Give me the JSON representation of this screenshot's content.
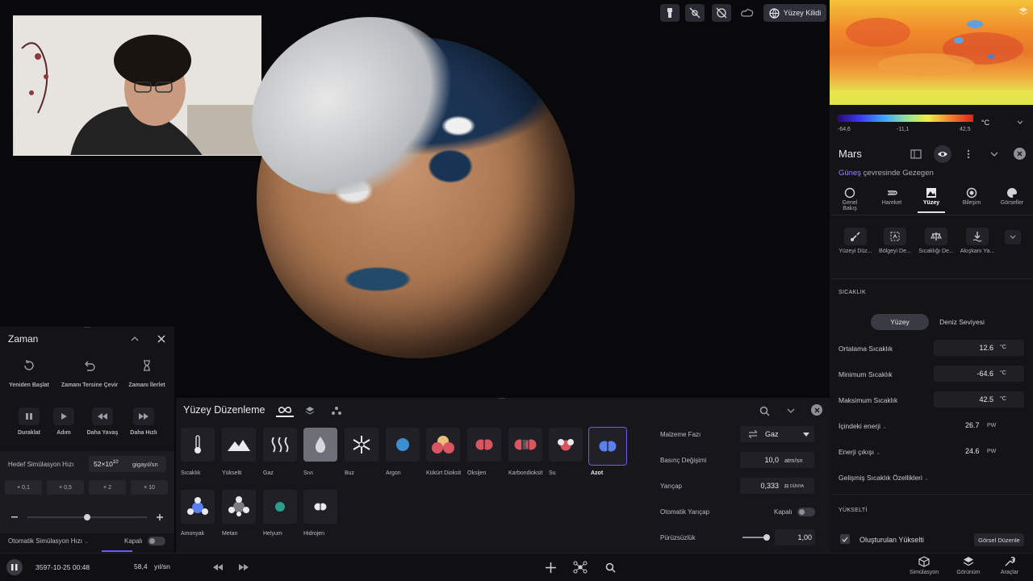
{
  "toolbar": {
    "surface_lock_label": "Yüzey Kilidi"
  },
  "legend": {
    "min": "-64,6",
    "mid": "-11,1",
    "max": "42,5",
    "unit": "°C"
  },
  "planet_panel": {
    "name": "Mars",
    "subtitle_link": "Güneş",
    "subtitle_rest": " çevresinde Gezegen",
    "tabs": [
      {
        "label": "Genel Bakış",
        "icon": "circle-icon"
      },
      {
        "label": "Hareket",
        "icon": "motion-icon"
      },
      {
        "label": "Yüzey",
        "icon": "surface-icon"
      },
      {
        "label": "Bileşim",
        "icon": "composition-icon"
      },
      {
        "label": "Görseller",
        "icon": "palette-icon"
      }
    ],
    "tools": [
      {
        "label": "Yüzeyi Düz...",
        "icon": "brush-icon"
      },
      {
        "label": "Bölgeyi De...",
        "icon": "region-icon"
      },
      {
        "label": "Sıcaklığı De...",
        "icon": "scale-icon"
      },
      {
        "label": "Akışkanı Ya...",
        "icon": "fluid-icon"
      }
    ],
    "temp_section": "SICAKLIK",
    "seg_surface": "Yüzey",
    "seg_sea": "Deniz Seviyesi",
    "rows": [
      {
        "label": "Ortalama Sıcaklık",
        "value": "12.6",
        "unit": "°C"
      },
      {
        "label": "Minimum Sıcaklık",
        "value": "-64.6",
        "unit": "°C"
      },
      {
        "label": "Maksimum Sıcaklık",
        "value": "42.5",
        "unit": "°C"
      }
    ],
    "energy_rows": [
      {
        "label": "İçindeki enerji",
        "value": "26.7",
        "unit": "PW"
      },
      {
        "label": "Enerji çıkışı",
        "value": "24.6",
        "unit": "PW"
      }
    ],
    "advanced": "Gelişmiş Sıcaklık Özellikleri",
    "elev_section": "YÜKSELTİ",
    "generated_elev": "Oluşturulan Yükselti",
    "visual_edit": "Görsel Düzenle"
  },
  "zaman": {
    "title": "Zaman",
    "buttons": [
      {
        "label": "Yeniden Başlat"
      },
      {
        "label": "Zamanı Tersine Çevir"
      },
      {
        "label": "Zamanı İlerlet"
      }
    ],
    "controls": [
      {
        "label": "Duraklat"
      },
      {
        "label": "Adım"
      },
      {
        "label": "Daha Yavaş"
      },
      {
        "label": "Daha Hızlı"
      }
    ],
    "target_label": "Hedef Simülasyon Hızı",
    "target_value": "52×10",
    "target_exp": "10",
    "target_unit": "gigayıl/sn",
    "multipliers": [
      "× 0,1",
      "× 0,5",
      "× 2",
      "× 10"
    ],
    "slider_value": 0.5,
    "auto_label": "Otomatik Simülasyon Hızı",
    "auto_state": "Kapalı"
  },
  "yuzey": {
    "title": "Yüzey Düzenleme",
    "materials": [
      {
        "label": "Sıcaklık",
        "icon": "thermometer-icon"
      },
      {
        "label": "Yükselti",
        "icon": "mountain-icon"
      },
      {
        "label": "Gaz",
        "icon": "gas-icon"
      },
      {
        "label": "Sıvı",
        "icon": "droplet-icon"
      },
      {
        "label": "Buz",
        "icon": "snowflake-icon"
      },
      {
        "label": "Argon",
        "icon": "argon-icon",
        "color": "#3b8fd0"
      },
      {
        "label": "Kükürt Dioksit",
        "icon": "sulfur-dioxide-icon"
      },
      {
        "label": "Oksijen",
        "icon": "oxygen-icon",
        "color": "#d9555f"
      },
      {
        "label": "Karbondioksit",
        "icon": "co2-icon"
      },
      {
        "label": "Su",
        "icon": "water-icon"
      },
      {
        "label": "Azot",
        "icon": "nitrogen-icon",
        "color": "#5a7ff0"
      }
    ],
    "materials2": [
      {
        "label": "Amonyak",
        "icon": "ammonia-icon"
      },
      {
        "label": "Metan",
        "icon": "methane-icon"
      },
      {
        "label": "Helyum",
        "icon": "helium-icon",
        "color": "#2a9d8f"
      },
      {
        "label": "Hidrojen",
        "icon": "hydrogen-icon"
      }
    ],
    "props": {
      "phase_label": "Malzeme Fazı",
      "phase_value": "Gaz",
      "pressure_label": "Basınç Değişimi",
      "pressure_value": "10,0",
      "pressure_unit": "atm/sn",
      "radius_label": "Yarıçap",
      "radius_value": "0,333",
      "radius_unit": "R",
      "radius_sub": "DÜNYA",
      "auto_radius_label": "Otomatik Yarıçap",
      "auto_radius_state": "Kapalı",
      "roughness_label": "Pürüzsüzlük",
      "roughness_value": "1,00"
    }
  },
  "bottom": {
    "date": "3597-10-25 00:48",
    "rate": "58,4",
    "rate_unit": "yıl/sn",
    "nav": [
      {
        "label": "Simülasyon",
        "icon": "cube-icon"
      },
      {
        "label": "Görünüm",
        "icon": "layers-icon"
      },
      {
        "label": "Araçlar",
        "icon": "wrench-icon"
      }
    ]
  }
}
